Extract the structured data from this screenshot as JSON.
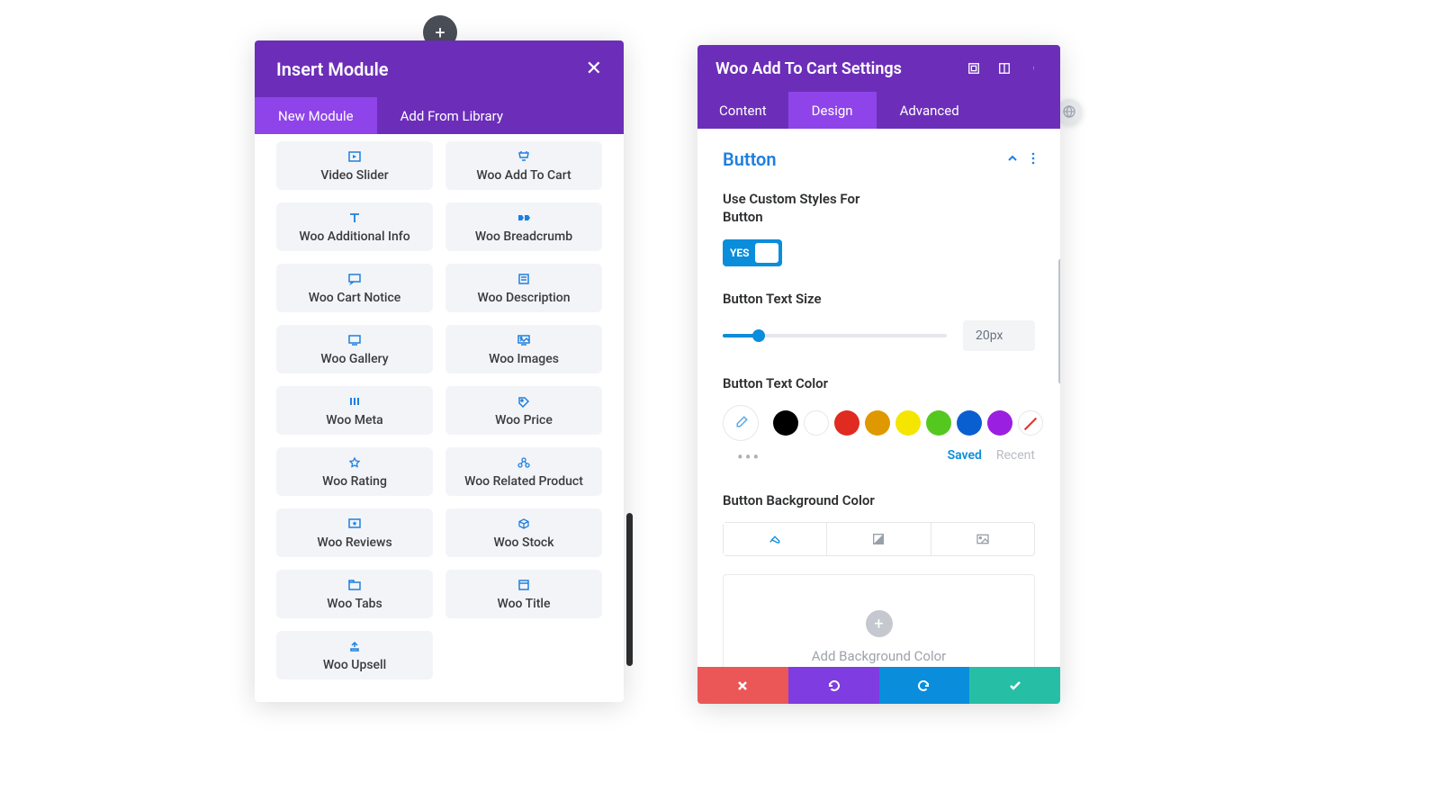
{
  "left_panel": {
    "title": "Insert Module",
    "tabs": {
      "new_module": "New Module",
      "add_from_library": "Add From Library"
    },
    "modules": [
      {
        "label": "Video Slider",
        "icon": "video-slider-icon"
      },
      {
        "label": "Woo Add To Cart",
        "icon": "cart-icon"
      },
      {
        "label": "Woo Additional Info",
        "icon": "text-icon"
      },
      {
        "label": "Woo Breadcrumb",
        "icon": "breadcrumb-icon"
      },
      {
        "label": "Woo Cart Notice",
        "icon": "message-icon"
      },
      {
        "label": "Woo Description",
        "icon": "description-icon"
      },
      {
        "label": "Woo Gallery",
        "icon": "gallery-icon"
      },
      {
        "label": "Woo Images",
        "icon": "images-icon"
      },
      {
        "label": "Woo Meta",
        "icon": "meta-icon"
      },
      {
        "label": "Woo Price",
        "icon": "price-icon"
      },
      {
        "label": "Woo Rating",
        "icon": "rating-icon"
      },
      {
        "label": "Woo Related Product",
        "icon": "related-icon"
      },
      {
        "label": "Woo Reviews",
        "icon": "reviews-icon"
      },
      {
        "label": "Woo Stock",
        "icon": "stock-icon"
      },
      {
        "label": "Woo Tabs",
        "icon": "tabs-icon"
      },
      {
        "label": "Woo Title",
        "icon": "title-icon"
      },
      {
        "label": "Woo Upsell",
        "icon": "upsell-icon"
      }
    ]
  },
  "right_panel": {
    "title": "Woo Add To Cart Settings",
    "tabs": {
      "content": "Content",
      "design": "Design",
      "advanced": "Advanced"
    },
    "section": "Button",
    "custom_styles_label": "Use Custom Styles For Button",
    "custom_styles_value": "YES",
    "text_size_label": "Button Text Size",
    "text_size_value": "20px",
    "text_color_label": "Button Text Color",
    "saved_label": "Saved",
    "recent_label": "Recent",
    "bg_color_label": "Button Background Color",
    "add_bg_label": "Add Background Color"
  },
  "colors": {
    "black": "#000000",
    "white": "#ffffff",
    "red": "#e02b20",
    "orange": "#e09800",
    "yellow": "#f4e600",
    "green": "#55c81f",
    "blue": "#0a5fd0",
    "purple": "#9b1fe0"
  }
}
